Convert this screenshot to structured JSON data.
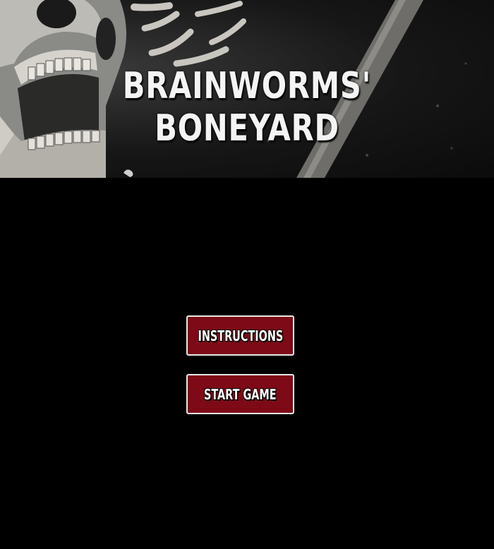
{
  "header": {
    "title": "BRAINWORMS' BONEYARD"
  },
  "menu": {
    "instructions_label": "INSTRUCTIONS",
    "start_label": "START GAME"
  },
  "colors": {
    "background": "#000000",
    "button": "#7d0a16",
    "button_border": "#e8e8e8",
    "title": "#f4f4f4"
  }
}
